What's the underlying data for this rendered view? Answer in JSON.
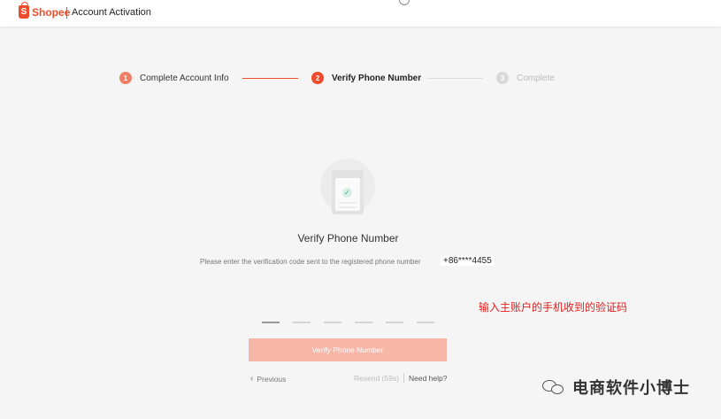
{
  "header": {
    "logo_text": "Shopee",
    "title": "Account Activation"
  },
  "steps": [
    {
      "number": "1",
      "label": "Complete Account Info",
      "state": "done"
    },
    {
      "number": "2",
      "label": "Verify Phone Number",
      "state": "active"
    },
    {
      "number": "3",
      "label": "Complete",
      "state": "pending"
    }
  ],
  "main": {
    "title": "Verify Phone Number",
    "instruction": "Please enter the verification code sent to the registered phone number",
    "phone_number": "+86****4455",
    "annotation": "输入主账户的手机收到的验证码",
    "code_slots": 6,
    "verify_button": "Verify Phone Number",
    "previous": "Previous",
    "resend": "Resend (59s)",
    "help": "Need help?"
  },
  "watermark": {
    "text": "电商软件小博士"
  },
  "colors": {
    "brand": "#ee4d2d",
    "button_disabled": "#f6b6a8",
    "annotation": "#e02020",
    "step_done": "#f07e64",
    "step_pending": "#d9d9d9"
  }
}
